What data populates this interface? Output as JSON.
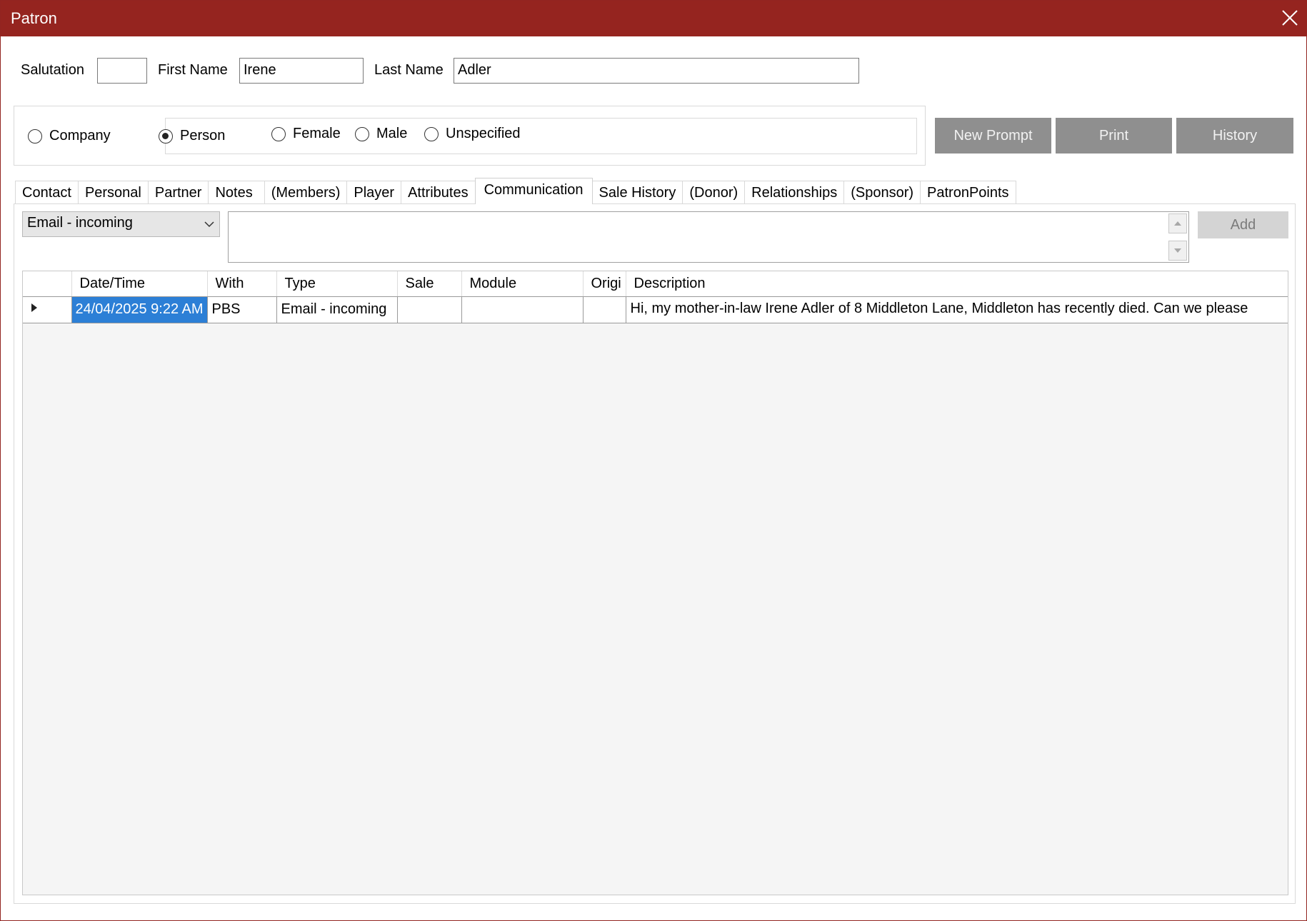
{
  "window": {
    "title": "Patron"
  },
  "name_row": {
    "salutation_label": "Salutation",
    "salutation_value": "",
    "first_name_label": "First Name",
    "first_name_value": "Irene",
    "last_name_label": "Last Name",
    "last_name_value": "Adler"
  },
  "patron_type": {
    "company_label": "Company",
    "company_selected": false,
    "person_label": "Person",
    "person_selected": true
  },
  "gender": {
    "female_label": "Female",
    "male_label": "Male",
    "unspecified_label": "Unspecified",
    "selected": "none"
  },
  "actions": {
    "new_prompt_label": "New Prompt",
    "print_label": "Print",
    "history_label": "History"
  },
  "tabs": [
    {
      "label": "Contact"
    },
    {
      "label": "Personal"
    },
    {
      "label": "Partner"
    },
    {
      "label": "Notes"
    },
    {
      "label": "(Members)"
    },
    {
      "label": "Player"
    },
    {
      "label": "Attributes"
    },
    {
      "label": "Communication"
    },
    {
      "label": "Sale History"
    },
    {
      "label": "(Donor)"
    },
    {
      "label": "Relationships"
    },
    {
      "label": "(Sponsor)"
    },
    {
      "label": "PatronPoints"
    }
  ],
  "active_tab": "Communication",
  "communication": {
    "type_value": "Email - incoming",
    "note_value": "",
    "add_label": "Add"
  },
  "grid": {
    "columns": [
      "Date/Time",
      "With",
      "Type",
      "Sale",
      "Module",
      "Origi",
      "Description"
    ],
    "rows": [
      {
        "datetime": "24/04/2025 9:22 AM",
        "with": "PBS",
        "type": "Email - incoming",
        "sale": "",
        "module": "",
        "origin": "",
        "description": "Hi, my mother-in-law Irene Adler of 8 Middleton Lane, Middleton has recently died. Can we please"
      }
    ]
  }
}
